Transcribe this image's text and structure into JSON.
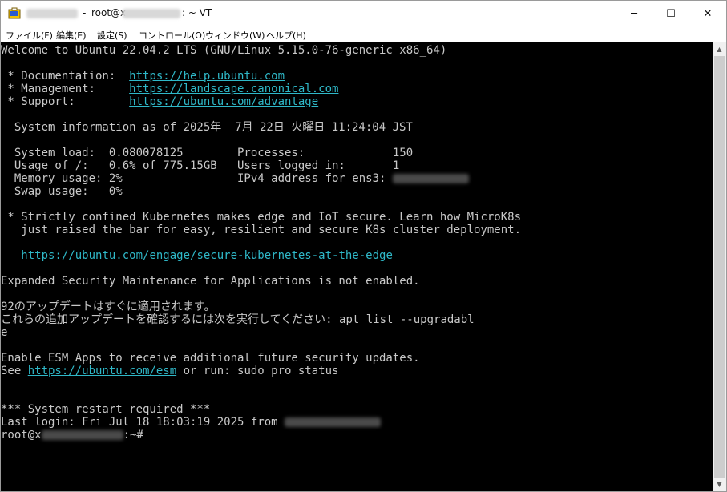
{
  "window": {
    "title_prefix": "-",
    "title_main": "root@x",
    "title_suffix": ": ~ VT",
    "controls": {
      "minimize": "─",
      "maximize": "☐",
      "close": "✕"
    }
  },
  "menu": [
    {
      "label": "ファイル(F)"
    },
    {
      "label": "編集(E)"
    },
    {
      "label": "設定(S)"
    },
    {
      "label": "コントロール(O)"
    },
    {
      "label": "ウィンドウ(W)"
    },
    {
      "label": "ヘルプ(H)"
    }
  ],
  "terminal": {
    "welcome": "Welcome to Ubuntu 22.04.2 LTS (GNU/Linux 5.15.0-76-generic x86_64)",
    "doc_label": " * Documentation:  ",
    "doc_url": "https://help.ubuntu.com",
    "mgmt_label": " * Management:     ",
    "mgmt_url": "https://landscape.canonical.com",
    "support_label": " * Support:        ",
    "support_url": "https://ubuntu.com/advantage",
    "sysinfo": "  System information as of 2025年  7月 22日 火曜日 11:24:04 JST",
    "sysload": "  System load:  0.080078125        Processes:             150",
    "usage": "  Usage of /:   0.6% of 775.15GB   Users logged in:       1",
    "memory": "  Memory usage: 2%                 IPv4 address for ens3:",
    "swap": "  Swap usage:   0%",
    "k8s1": " * Strictly confined Kubernetes makes edge and IoT secure. Learn how MicroK8s",
    "k8s2": "   just raised the bar for easy, resilient and secure K8s cluster deployment.",
    "k8s_url_indent": "   ",
    "k8s_url": "https://ubuntu.com/engage/secure-kubernetes-at-the-edge",
    "esm_notice": "Expanded Security Maintenance for Applications is not enabled.",
    "updates1": "92のアップデートはすぐに適用されます。",
    "updates2": "これらの追加アップデートを確認するには次を実行してください: apt list --upgradabl",
    "updates3": "e",
    "enable_esm": "Enable ESM Apps to receive additional future security updates.",
    "see_prefix": "See ",
    "see_url": "https://ubuntu.com/esm",
    "see_suffix": " or run: sudo pro status",
    "restart": "*** System restart required ***",
    "last_login": "Last login: Fri Jul 18 18:03:19 2025 from ",
    "prompt_user": "root@x",
    "prompt_suffix": ":~#"
  }
}
